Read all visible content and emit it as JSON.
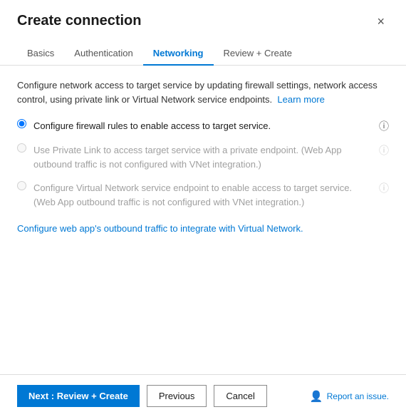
{
  "dialog": {
    "title": "Create connection",
    "close_label": "×"
  },
  "tabs": [
    {
      "id": "basics",
      "label": "Basics",
      "active": false
    },
    {
      "id": "authentication",
      "label": "Authentication",
      "active": false
    },
    {
      "id": "networking",
      "label": "Networking",
      "active": true
    },
    {
      "id": "review-create",
      "label": "Review + Create",
      "active": false
    }
  ],
  "content": {
    "description": "Configure network access to target service by updating firewall settings, network access control, using private link or Virtual Network service endpoints.",
    "learn_more": "Learn more",
    "options": [
      {
        "id": "opt1",
        "label": "Configure firewall rules to enable access to target service.",
        "checked": true,
        "disabled": false,
        "has_info": true
      },
      {
        "id": "opt2",
        "label": "Use Private Link to access target service with a private endpoint. (Web App outbound traffic is not configured with VNet integration.)",
        "checked": false,
        "disabled": true,
        "has_info": true
      },
      {
        "id": "opt3",
        "label": "Configure Virtual Network service endpoint to enable access to target service. (Web App outbound traffic is not configured with VNet integration.)",
        "checked": false,
        "disabled": true,
        "has_info": true
      }
    ],
    "link_text": "Configure web app's outbound traffic to integrate with Virtual Network."
  },
  "footer": {
    "next_label": "Next : Review + Create",
    "previous_label": "Previous",
    "cancel_label": "Cancel",
    "report_label": "Report an issue."
  }
}
